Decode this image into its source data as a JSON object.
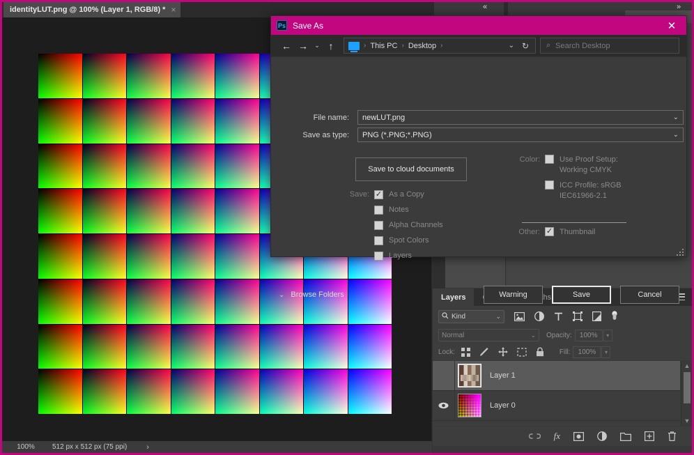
{
  "app": {
    "document_tab": {
      "title": "identityLUT.png @ 100% (Layer 1, RGB/8) *",
      "close_glyph": "×"
    },
    "panel_collapse_left": "«",
    "panel_collapse_right": "»"
  },
  "status_bar": {
    "zoom": "100%",
    "doc_size": "512 px x 512 px (75 ppi)",
    "expand_arrow": "›"
  },
  "layers_panel": {
    "tabs": [
      {
        "label": "Layers",
        "active": true
      },
      {
        "label": "Channels",
        "active": false
      },
      {
        "label": "Paths",
        "active": false
      }
    ],
    "menu_icon": "hamburger-icon",
    "filter": {
      "search_icon": "🔍",
      "kind_label": "Kind",
      "caret": "⌄",
      "icons": [
        "pixel-layer-icon",
        "adjustment-layer-icon",
        "type-layer-icon",
        "shape-layer-icon",
        "smart-object-icon",
        "filter-toggle-icon"
      ]
    },
    "blend": {
      "mode": "Normal",
      "caret": "⌄",
      "opacity_label": "Opacity:",
      "opacity_value": "100%"
    },
    "lock": {
      "label": "Lock:",
      "icons": [
        "lock-transparent-pixels-icon",
        "lock-image-pixels-icon",
        "lock-position-icon",
        "lock-artboard-nesting-icon",
        "lock-all-icon"
      ],
      "fill_label": "Fill:",
      "fill_value": "100%"
    },
    "layers": [
      {
        "name": "Layer 1",
        "visible": false,
        "selected": true,
        "thumb": "photo"
      },
      {
        "name": "Layer 0",
        "visible": true,
        "selected": false,
        "thumb": "lut"
      }
    ],
    "eye_glyph": "◉",
    "scroll": {
      "up": "▲",
      "down": "▼"
    },
    "footer_icons": [
      "link-layers-icon",
      "add-layer-style-icon",
      "add-layer-mask-icon",
      "new-fill-adjustment-icon",
      "new-group-icon",
      "new-layer-icon",
      "delete-layer-icon"
    ],
    "footer_fx_label": "fx"
  },
  "dialog": {
    "title": "Save As",
    "app_badge": "Ps",
    "close_glyph": "✕",
    "nav": {
      "back": "←",
      "forward": "→",
      "recent_caret": "⌄",
      "up": "↑",
      "breadcrumbs": [
        "This PC",
        "Desktop"
      ],
      "separator": "›",
      "path_caret": "⌄",
      "refresh": "↻",
      "search_icon": "⌕",
      "search_placeholder": "Search Desktop"
    },
    "fields": [
      {
        "label": "File name:",
        "value": "newLUT.png",
        "caret": "⌄"
      },
      {
        "label": "Save as type:",
        "value": "PNG (*.PNG;*.PNG)",
        "caret": "⌄"
      }
    ],
    "cloud_button": "Save to cloud documents",
    "save_section_label": "Save:",
    "save_options": [
      {
        "label": "As a Copy",
        "checked": true
      },
      {
        "label": "Notes",
        "checked": false
      },
      {
        "label": "Alpha Channels",
        "checked": false
      },
      {
        "label": "Spot Colors",
        "checked": false
      },
      {
        "label": "Layers",
        "checked": false
      }
    ],
    "color_section_label": "Color:",
    "color_options": [
      {
        "label": "Use Proof Setup:",
        "sublabel": "Working CMYK",
        "checked": false
      },
      {
        "label": "ICC Profile:  sRGB",
        "sublabel": "IEC61966-2.1",
        "checked": false
      }
    ],
    "other_section_label": "Other:",
    "other_options": [
      {
        "label": "Thumbnail",
        "checked": true
      }
    ],
    "browse_folders": {
      "caret": "⌄",
      "label": "Browse Folders"
    },
    "buttons": [
      {
        "label": "Warning",
        "default": false
      },
      {
        "label": "Save",
        "default": true
      },
      {
        "label": "Cancel",
        "default": false
      }
    ],
    "check_glyph": "✓"
  },
  "canvas": {
    "document_name": "identityLUT.png",
    "description": "Hald CLUT identity lookup table, 8x8 grid of RGB gradient tiles",
    "grid_cols": 8,
    "grid_rows": 8,
    "blue_levels": [
      0,
      36,
      73,
      109,
      146,
      182,
      219,
      255
    ]
  },
  "colors": {
    "accent_magenta": "#c2067f",
    "dialog_bg": "#3b3b3b",
    "panel_bg": "#383838",
    "canvas_bg": "#1d1d1d",
    "title_bar": "#c2067f"
  }
}
